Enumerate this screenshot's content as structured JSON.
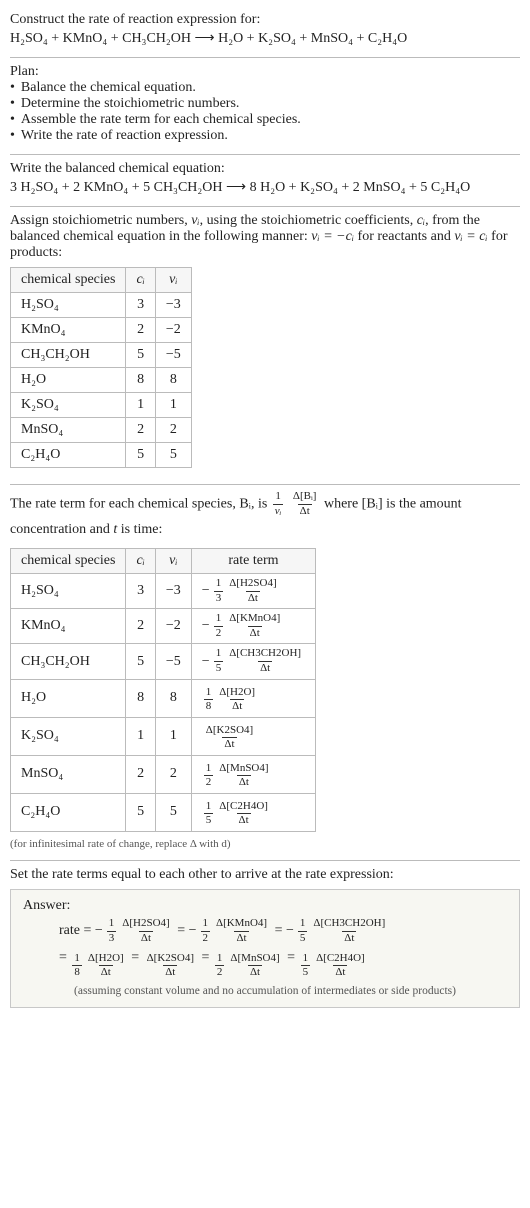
{
  "title": {
    "line1": "Construct the rate of reaction expression for:",
    "eq_left": "H₂SO₄ + KMnO₄ + CH₃CH₂OH",
    "arrow": "⟶",
    "eq_right": "H₂O + K₂SO₄ + MnSO₄ + C₂H₄O"
  },
  "plan": {
    "label": "Plan:",
    "items": [
      "Balance the chemical equation.",
      "Determine the stoichiometric numbers.",
      "Assemble the rate term for each chemical species.",
      "Write the rate of reaction expression."
    ]
  },
  "balanced": {
    "heading": "Write the balanced chemical equation:",
    "eq_left": "3 H₂SO₄ + 2 KMnO₄ + 5 CH₃CH₂OH",
    "arrow": "⟶",
    "eq_right": "8 H₂O + K₂SO₄ + 2 MnSO₄ + 5 C₂H₄O"
  },
  "stoich_intro": {
    "part1": "Assign stoichiometric numbers, ",
    "nu_i": "νᵢ",
    "part2": ", using the stoichiometric coefficients, ",
    "c_i": "cᵢ",
    "part3": ", from the balanced chemical equation in the following manner: ",
    "rel1": "νᵢ = −cᵢ",
    "part4": " for reactants and ",
    "rel2": "νᵢ = cᵢ",
    "part5": " for products:"
  },
  "stoich_table": {
    "headers": [
      "chemical species",
      "cᵢ",
      "νᵢ"
    ],
    "rows": [
      {
        "species": "H₂SO₄",
        "c": "3",
        "nu": "−3"
      },
      {
        "species": "KMnO₄",
        "c": "2",
        "nu": "−2"
      },
      {
        "species": "CH₃CH₂OH",
        "c": "5",
        "nu": "−5"
      },
      {
        "species": "H₂O",
        "c": "8",
        "nu": "8"
      },
      {
        "species": "K₂SO₄",
        "c": "1",
        "nu": "1"
      },
      {
        "species": "MnSO₄",
        "c": "2",
        "nu": "2"
      },
      {
        "species": "C₂H₄O",
        "c": "5",
        "nu": "5"
      }
    ]
  },
  "rate_intro": {
    "part1": "The rate term for each chemical species, Bᵢ, is ",
    "frac1_num": "1",
    "frac1_den": "νᵢ",
    "frac2_num": "Δ[Bᵢ]",
    "frac2_den": "Δt",
    "part2": " where [Bᵢ] is the amount concentration and ",
    "t": "t",
    "part3": " is time:"
  },
  "rate_table": {
    "headers": [
      "chemical species",
      "cᵢ",
      "νᵢ",
      "rate term"
    ],
    "rows": [
      {
        "species": "H₂SO₄",
        "c": "3",
        "nu": "−3",
        "sign": "−",
        "coef_num": "1",
        "coef_den": "3",
        "delta_num": "Δ[H2SO4]",
        "delta_den": "Δt"
      },
      {
        "species": "KMnO₄",
        "c": "2",
        "nu": "−2",
        "sign": "−",
        "coef_num": "1",
        "coef_den": "2",
        "delta_num": "Δ[KMnO4]",
        "delta_den": "Δt"
      },
      {
        "species": "CH₃CH₂OH",
        "c": "5",
        "nu": "−5",
        "sign": "−",
        "coef_num": "1",
        "coef_den": "5",
        "delta_num": "Δ[CH3CH2OH]",
        "delta_den": "Δt"
      },
      {
        "species": "H₂O",
        "c": "8",
        "nu": "8",
        "sign": "",
        "coef_num": "1",
        "coef_den": "8",
        "delta_num": "Δ[H2O]",
        "delta_den": "Δt"
      },
      {
        "species": "K₂SO₄",
        "c": "1",
        "nu": "1",
        "sign": "",
        "coef_num": "",
        "coef_den": "",
        "delta_num": "Δ[K2SO4]",
        "delta_den": "Δt"
      },
      {
        "species": "MnSO₄",
        "c": "2",
        "nu": "2",
        "sign": "",
        "coef_num": "1",
        "coef_den": "2",
        "delta_num": "Δ[MnSO4]",
        "delta_den": "Δt"
      },
      {
        "species": "C₂H₄O",
        "c": "5",
        "nu": "5",
        "sign": "",
        "coef_num": "1",
        "coef_den": "5",
        "delta_num": "Δ[C2H4O]",
        "delta_den": "Δt"
      }
    ],
    "footnote": "(for infinitesimal rate of change, replace Δ with d)"
  },
  "final_heading": "Set the rate terms equal to each other to arrive at the rate expression:",
  "answer": {
    "label": "Answer:",
    "rate_eq": "rate =",
    "eq_sign": " = ",
    "terms": [
      {
        "sign": "−",
        "coef_num": "1",
        "coef_den": "3",
        "delta_num": "Δ[H2SO4]",
        "delta_den": "Δt"
      },
      {
        "sign": "−",
        "coef_num": "1",
        "coef_den": "2",
        "delta_num": "Δ[KMnO4]",
        "delta_den": "Δt"
      },
      {
        "sign": "−",
        "coef_num": "1",
        "coef_den": "5",
        "delta_num": "Δ[CH3CH2OH]",
        "delta_den": "Δt"
      },
      {
        "sign": "",
        "coef_num": "1",
        "coef_den": "8",
        "delta_num": "Δ[H2O]",
        "delta_den": "Δt"
      },
      {
        "sign": "",
        "coef_num": "",
        "coef_den": "",
        "delta_num": "Δ[K2SO4]",
        "delta_den": "Δt"
      },
      {
        "sign": "",
        "coef_num": "1",
        "coef_den": "2",
        "delta_num": "Δ[MnSO4]",
        "delta_den": "Δt"
      },
      {
        "sign": "",
        "coef_num": "1",
        "coef_den": "5",
        "delta_num": "Δ[C2H4O]",
        "delta_den": "Δt"
      }
    ],
    "note": "(assuming constant volume and no accumulation of intermediates or side products)"
  },
  "chart_data": {
    "type": "table",
    "tables": [
      {
        "columns": [
          "chemical species",
          "c_i",
          "nu_i"
        ],
        "rows": [
          [
            "H2SO4",
            3,
            -3
          ],
          [
            "KMnO4",
            2,
            -2
          ],
          [
            "CH3CH2OH",
            5,
            -5
          ],
          [
            "H2O",
            8,
            8
          ],
          [
            "K2SO4",
            1,
            1
          ],
          [
            "MnSO4",
            2,
            2
          ],
          [
            "C2H4O",
            5,
            5
          ]
        ]
      },
      {
        "columns": [
          "chemical species",
          "c_i",
          "nu_i",
          "rate term"
        ],
        "rows": [
          [
            "H2SO4",
            3,
            -3,
            "-(1/3) Δ[H2SO4]/Δt"
          ],
          [
            "KMnO4",
            2,
            -2,
            "-(1/2) Δ[KMnO4]/Δt"
          ],
          [
            "CH3CH2OH",
            5,
            -5,
            "-(1/5) Δ[CH3CH2OH]/Δt"
          ],
          [
            "H2O",
            8,
            8,
            "(1/8) Δ[H2O]/Δt"
          ],
          [
            "K2SO4",
            1,
            1,
            "Δ[K2SO4]/Δt"
          ],
          [
            "MnSO4",
            2,
            2,
            "(1/2) Δ[MnSO4]/Δt"
          ],
          [
            "C2H4O",
            5,
            5,
            "(1/5) Δ[C2H4O]/Δt"
          ]
        ]
      }
    ]
  }
}
